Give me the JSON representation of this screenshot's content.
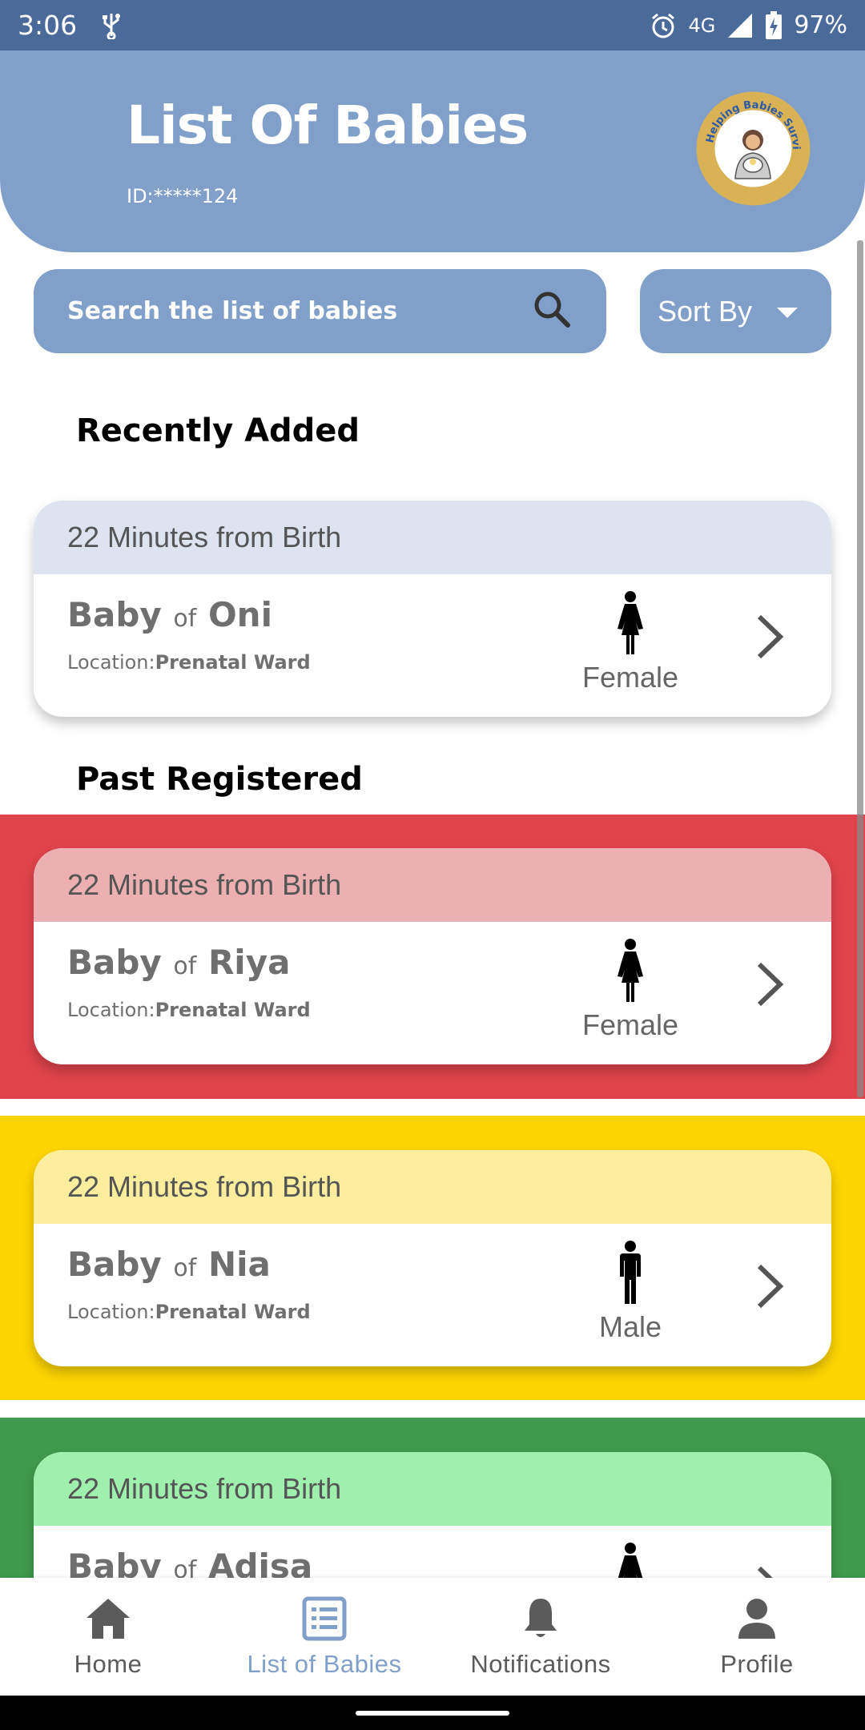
{
  "status_bar": {
    "time": "3:06",
    "network": "4G",
    "battery": "97%"
  },
  "header": {
    "title": "List Of Babies",
    "id_text": "ID:*****124",
    "logo_text": "Helping Babies Survive"
  },
  "search": {
    "placeholder": "Search the list of babies"
  },
  "sort": {
    "label": "Sort By"
  },
  "sections": {
    "recent": "Recently Added",
    "past": "Past Registered"
  },
  "colors": {
    "primary": "#81a0c9",
    "status_bar": "#4a6b9a",
    "red_band": "#e0434b",
    "red_head": "#ecb0b3",
    "yellow_band": "#fdd400",
    "yellow_head": "#fdee9e",
    "green_band": "#3f9a4d",
    "green_head": "#9ff0ac",
    "recent_head": "#dde3ef"
  },
  "cards": [
    {
      "time": "22 Minutes from Birth",
      "baby": "Baby",
      "of": "of",
      "mother": "Oni",
      "location_label": "Location:",
      "location": "Prenatal Ward",
      "gender": "Female",
      "gender_icon": "female-icon"
    },
    {
      "time": "22 Minutes from Birth",
      "baby": "Baby",
      "of": "of",
      "mother": "Riya",
      "location_label": "Location:",
      "location": "Prenatal Ward",
      "gender": "Female",
      "gender_icon": "female-icon"
    },
    {
      "time": "22 Minutes from Birth",
      "baby": "Baby",
      "of": "of",
      "mother": "Nia",
      "location_label": "Location:",
      "location": "Prenatal Ward",
      "gender": "Male",
      "gender_icon": "male-icon"
    },
    {
      "time": "22 Minutes from Birth",
      "baby": "Baby",
      "of": "of",
      "mother": "Adisa",
      "gender_icon": "female-icon"
    }
  ],
  "bottom_nav": [
    {
      "label": "Home",
      "icon": "home-icon"
    },
    {
      "label": "List of Babies",
      "icon": "list-icon",
      "active": true
    },
    {
      "label": "Notifications",
      "icon": "bell-icon"
    },
    {
      "label": "Profile",
      "icon": "profile-icon"
    }
  ]
}
